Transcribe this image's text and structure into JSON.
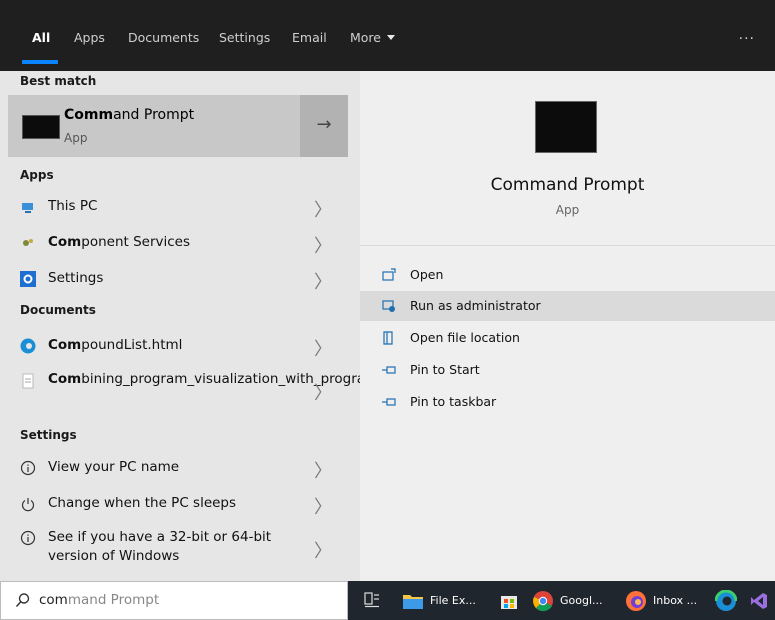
{
  "tabs": {
    "all": "All",
    "apps": "Apps",
    "documents": "Documents",
    "settings": "Settings",
    "email": "Email",
    "more": "More",
    "overflow": "..."
  },
  "best_match": {
    "header": "Best match",
    "title_match": "Comm",
    "title_rest": "and Prompt",
    "subtitle": "App"
  },
  "apps": {
    "header": "Apps",
    "items": [
      {
        "match": "",
        "rest": "This PC"
      },
      {
        "match": "Com",
        "rest": "ponent Services"
      },
      {
        "match": "",
        "rest": "Settings"
      }
    ]
  },
  "documents": {
    "header": "Documents",
    "items": [
      {
        "match": "Com",
        "rest": "poundList.html"
      },
      {
        "match": "Com",
        "rest": "bining_program_visualization_with_programming_w.pdf"
      }
    ]
  },
  "settings": {
    "header": "Settings",
    "items": [
      {
        "label": "View your PC name"
      },
      {
        "label": "Change when the PC sleeps"
      },
      {
        "label": "See if you have a 32-bit or 64-bit version of Windows"
      }
    ]
  },
  "preview": {
    "title": "Command Prompt",
    "subtitle": "App",
    "actions": [
      {
        "label": "Open"
      },
      {
        "label": "Run as administrator"
      },
      {
        "label": "Open file location"
      },
      {
        "label": "Pin to Start"
      },
      {
        "label": "Pin to taskbar"
      }
    ]
  },
  "search": {
    "typed": "com",
    "suggest": "mand Prompt"
  },
  "taskbar": {
    "file_explorer": "File Ex...",
    "chrome": "Googl...",
    "firefox": "Inbox ..."
  },
  "colors": {
    "accent": "#0a84ff",
    "tab_bar": "#1f1f1f",
    "left_bg": "#e6e6e6",
    "right_bg": "#efefef",
    "best_match_bg": "#c8c8c8",
    "taskbar_bg": "#20262e"
  }
}
